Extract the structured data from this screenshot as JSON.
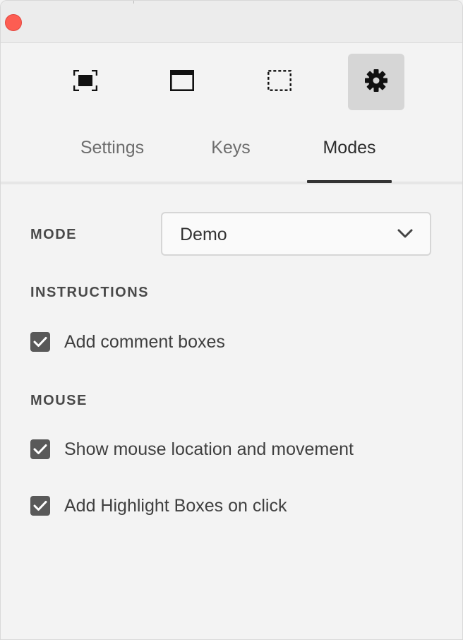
{
  "window": {
    "close_color": "#fd5d52"
  },
  "toolbar": {
    "tools": [
      {
        "name": "capture-screen",
        "icon": "fullscreen-capture-icon"
      },
      {
        "name": "capture-window",
        "icon": "window-capture-icon"
      },
      {
        "name": "capture-region",
        "icon": "region-capture-icon"
      },
      {
        "name": "settings",
        "icon": "gear-icon",
        "active": true
      }
    ]
  },
  "tabs": {
    "items": [
      "Settings",
      "Keys",
      "Modes"
    ],
    "active": "Modes"
  },
  "mode": {
    "label": "MODE",
    "selected": "Demo"
  },
  "instructions": {
    "label": "INSTRUCTIONS",
    "options": [
      {
        "label": "Add comment boxes",
        "checked": true
      }
    ]
  },
  "mouse": {
    "label": "MOUSE",
    "options": [
      {
        "label": "Show mouse location and movement",
        "checked": true
      },
      {
        "label": "Add Highlight Boxes on click",
        "checked": true
      }
    ]
  }
}
